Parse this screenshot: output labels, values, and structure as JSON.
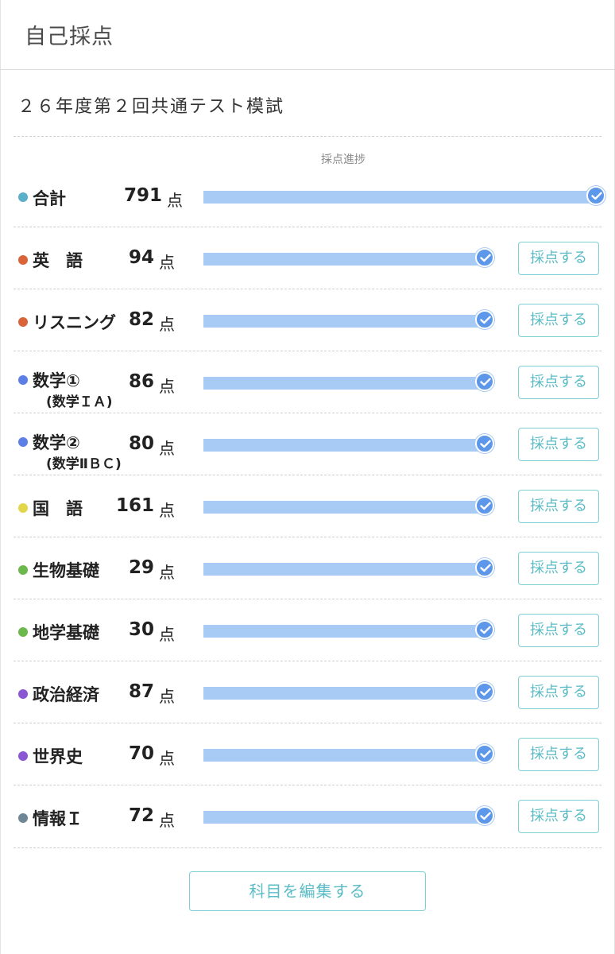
{
  "header": {
    "title": "自己採点"
  },
  "exam": {
    "title": "２６年度第２回共通テスト模試"
  },
  "progress_caption": "採点進捗",
  "unit": "点",
  "grade_button_label": "採点する",
  "edit_button_label": "科目を編集する",
  "total": {
    "label": "合計",
    "score": "791",
    "dot_color": "#5ab0c8",
    "progress": 1.0
  },
  "subjects": [
    {
      "label": "英　語",
      "sub": "",
      "score": "94",
      "dot_color": "#d9643a",
      "progress": 1.0
    },
    {
      "label": "リスニング",
      "sub": "",
      "score": "82",
      "dot_color": "#d9643a",
      "progress": 1.0
    },
    {
      "label": "数学①",
      "sub": "(数学ＩＡ)",
      "score": "86",
      "dot_color": "#5b7fe6",
      "progress": 1.0
    },
    {
      "label": "数学②",
      "sub": "(数学ⅡＢＣ)",
      "score": "80",
      "dot_color": "#5b7fe6",
      "progress": 1.0
    },
    {
      "label": "国　語",
      "sub": "",
      "score": "161",
      "dot_color": "#e2d64a",
      "progress": 1.0
    },
    {
      "label": "生物基礎",
      "sub": "",
      "score": "29",
      "dot_color": "#6db84a",
      "progress": 1.0
    },
    {
      "label": "地学基礎",
      "sub": "",
      "score": "30",
      "dot_color": "#6db84a",
      "progress": 1.0
    },
    {
      "label": "政治経済",
      "sub": "",
      "score": "87",
      "dot_color": "#8a56d4",
      "progress": 1.0
    },
    {
      "label": "世界史",
      "sub": "",
      "score": "70",
      "dot_color": "#8a56d4",
      "progress": 1.0
    },
    {
      "label": "情報Ｉ",
      "sub": "",
      "score": "72",
      "dot_color": "#6f8694",
      "progress": 1.0
    }
  ]
}
